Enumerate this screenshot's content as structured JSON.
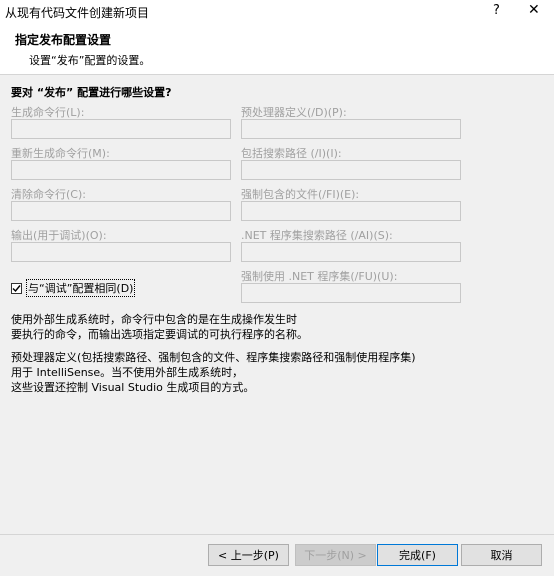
{
  "window": {
    "title": "从现有代码文件创建新项目",
    "help": "?",
    "close": "✕"
  },
  "header": {
    "title": "指定发布配置设置",
    "subtitle": "设置“发布”配置的设置。"
  },
  "question": "要对 “发布” 配置进行哪些设置?",
  "fields": {
    "build_command": {
      "label": "生成命令行(L):",
      "value": ""
    },
    "rebuild_command": {
      "label": "重新生成命令行(M):",
      "value": ""
    },
    "clean_command": {
      "label": "清除命令行(C):",
      "value": ""
    },
    "output": {
      "label": "输出(用于调试)(O):",
      "value": ""
    },
    "preprocessor": {
      "label": "预处理器定义(/D)(P):",
      "value": ""
    },
    "include_path": {
      "label": "包括搜索路径 (/I)(I):",
      "value": ""
    },
    "forced_include": {
      "label": "强制包含的文件(/FI)(E):",
      "value": ""
    },
    "assembly_search": {
      "label": ".NET 程序集搜索路径 (/AI)(S):",
      "value": ""
    },
    "forced_using": {
      "label": "强制使用 .NET 程序集(/FU)(U):",
      "value": ""
    }
  },
  "same_as_debug": {
    "label": "与“调试”配置相同(D)",
    "checked": true
  },
  "description": {
    "line1": "使用外部生成系统时，命令行中包含的是在生成操作发生时",
    "line2": "要执行的命令，而输出选项指定要调试的可执行程序的名称。",
    "line3": "预处理器定义(包括搜索路径、强制包含的文件、程序集搜索路径和强制使用程序集)",
    "line4": "用于 IntelliSense。当不使用外部生成系统时，",
    "line5": "这些设置还控制 Visual Studio 生成项目的方式。"
  },
  "buttons": {
    "back": "< 上一步(P)",
    "next": "下一步(N) >",
    "finish": "完成(F)",
    "cancel": "取消"
  }
}
